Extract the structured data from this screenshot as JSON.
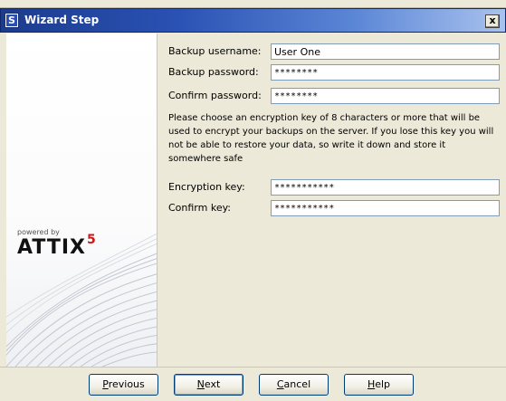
{
  "window": {
    "title": "Wizard Step",
    "close_label": "x"
  },
  "brand": {
    "powered_by": "powered by",
    "logo_text": "ATTIX",
    "logo_superscript": "5",
    "superscript_color": "#cc1a1a"
  },
  "form": {
    "backup_username_label": "Backup username:",
    "backup_username_value": "User One",
    "backup_password_label": "Backup password:",
    "backup_password_value": "********",
    "confirm_password_label": "Confirm password:",
    "confirm_password_value": "********",
    "instructions": "Please choose an encryption key of 8 characters or more that will be used to encrypt your backups on the server. If you lose this key you will not be able to restore your data, so write it down and store it somewhere safe",
    "encryption_key_label": "Encryption key:",
    "encryption_key_value": "***********",
    "confirm_key_label": "Confirm key:",
    "confirm_key_value": "***********"
  },
  "buttons": {
    "previous": {
      "first": "P",
      "rest": "revious"
    },
    "next": {
      "first": "N",
      "rest": "ext"
    },
    "cancel": {
      "first": "C",
      "rest": "ancel"
    },
    "help": {
      "first": "H",
      "rest": "elp"
    }
  },
  "colors": {
    "title_gradient_start": "#1c3b8d",
    "title_gradient_end": "#a9c2ee",
    "dialog_background": "#ece9d8",
    "field_border": "#7f9db9"
  }
}
